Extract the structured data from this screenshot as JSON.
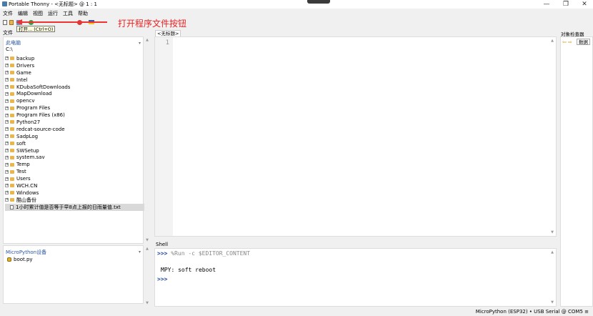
{
  "window": {
    "title": "Portable Thonny  -  <无标题>  @  1 : 1",
    "minimize": "—",
    "maximize": "❐",
    "close": "✕"
  },
  "menu": [
    "文件",
    "编辑",
    "视图",
    "运行",
    "工具",
    "帮助"
  ],
  "toolbar": {
    "tooltip": "打开... (Ctrl+O)",
    "annotation": "打开程序文件按钮"
  },
  "files": {
    "tab_label": "文件",
    "location_title": "此电脑",
    "location_path": "C:\\",
    "tree": [
      {
        "label": "backup",
        "type": "folder"
      },
      {
        "label": "Drivers",
        "type": "folder"
      },
      {
        "label": "Game",
        "type": "folder"
      },
      {
        "label": "Intel",
        "type": "folder"
      },
      {
        "label": "KDubaSoftDownloads",
        "type": "folder"
      },
      {
        "label": "MapDownload",
        "type": "folder"
      },
      {
        "label": "opencv",
        "type": "folder"
      },
      {
        "label": "Program Files",
        "type": "folder"
      },
      {
        "label": "Program Files (x86)",
        "type": "folder"
      },
      {
        "label": "Python27",
        "type": "folder"
      },
      {
        "label": "redcat-source-code",
        "type": "folder"
      },
      {
        "label": "SadpLog",
        "type": "folder"
      },
      {
        "label": "soft",
        "type": "folder"
      },
      {
        "label": "SWSetup",
        "type": "folder"
      },
      {
        "label": "system.sav",
        "type": "folder"
      },
      {
        "label": "Temp",
        "type": "folder"
      },
      {
        "label": "Test",
        "type": "folder"
      },
      {
        "label": "Users",
        "type": "folder"
      },
      {
        "label": "WCH.CN",
        "type": "folder"
      },
      {
        "label": "Windows",
        "type": "folder"
      },
      {
        "label": "酷山备份",
        "type": "folder"
      },
      {
        "label": "1小时累计值是否等于早8点上报的日雨量值.txt",
        "type": "file"
      }
    ]
  },
  "micropython_panel": {
    "title": "MicroPython设备",
    "file": "boot.py"
  },
  "editor": {
    "tab_label": "<无标题>",
    "line_number": "1"
  },
  "shell": {
    "tab_label": "Shell",
    "prompt": ">>>",
    "command": "%Run -c $EDITOR_CONTENT",
    "output": "MPY: soft reboot"
  },
  "inspector": {
    "tab_label": "对象检查器",
    "data_tab": "数据"
  },
  "status": {
    "text": "MicroPython (ESP32)  •  USB Serial @ COM5  ≡"
  }
}
